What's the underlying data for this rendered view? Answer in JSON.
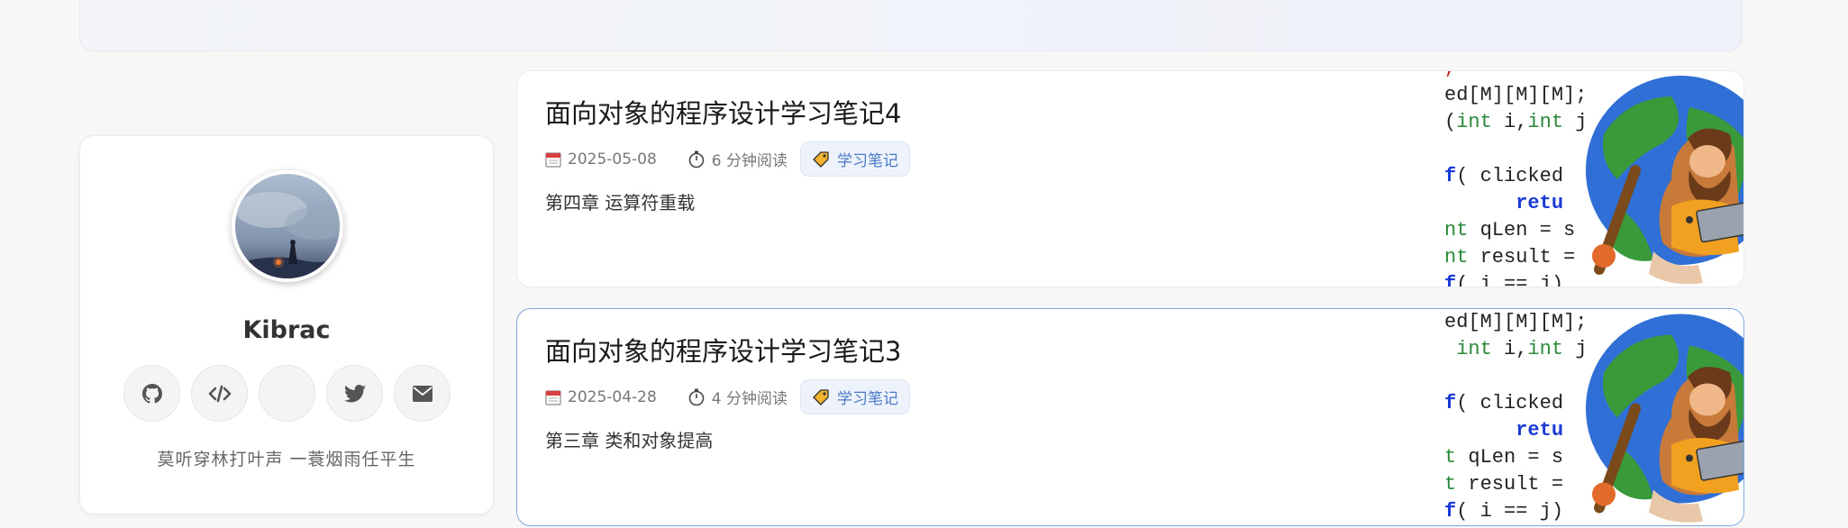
{
  "profile": {
    "name": "Kibrac",
    "bio": "莫听穿林打叶声 一蓑烟雨任平生",
    "social": [
      {
        "icon": "github-icon"
      },
      {
        "icon": "code-icon"
      },
      {
        "icon": "blank-icon"
      },
      {
        "icon": "twitter-icon"
      },
      {
        "icon": "mail-icon"
      }
    ]
  },
  "posts": [
    {
      "title": "面向对象的程序设计学习笔记4",
      "date": "2025-05-08",
      "read_time": "6 分钟阅读",
      "tag": "学习笔记",
      "excerpt": "第四章 运算符重载"
    },
    {
      "title": "面向对象的程序设计学习笔记3",
      "date": "2025-04-28",
      "read_time": "4 分钟阅读",
      "tag": "学习笔记",
      "excerpt": "第三章 类和对象提高"
    }
  ],
  "colors": {
    "accent": "#4a7ac8",
    "highlight_border": "#7ea8e0",
    "background": "#f7f7f8"
  }
}
